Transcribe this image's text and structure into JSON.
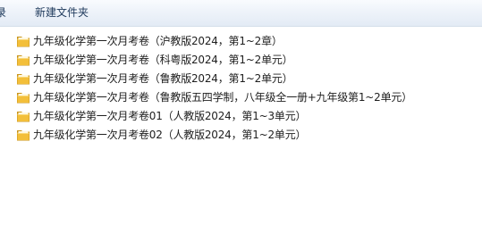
{
  "toolbar": {
    "cut_label": "录",
    "new_folder_label": "新建文件夹"
  },
  "files": [
    {
      "name": "九年级化学第一次月考卷（沪教版2024，第1~2章）",
      "icon": "folder-icon"
    },
    {
      "name": "九年级化学第一次月考卷（科粤版2024，第1~2单元）",
      "icon": "folder-icon"
    },
    {
      "name": "九年级化学第一次月考卷（鲁教版2024，第1~2单元）",
      "icon": "folder-icon"
    },
    {
      "name": "九年级化学第一次月考卷（鲁教版五四学制，八年级全一册+九年级第1~2单元）",
      "icon": "folder-icon"
    },
    {
      "name": "九年级化学第一次月考卷01（人教版2024，第1~3单元）",
      "icon": "folder-icon"
    },
    {
      "name": "九年级化学第一次月考卷02（人教版2024，第1~2单元）",
      "icon": "folder-icon"
    }
  ],
  "colors": {
    "toolbar_text": "#1e395b",
    "folder_yellow": "#f5c84a",
    "folder_dark": "#c9951c"
  }
}
